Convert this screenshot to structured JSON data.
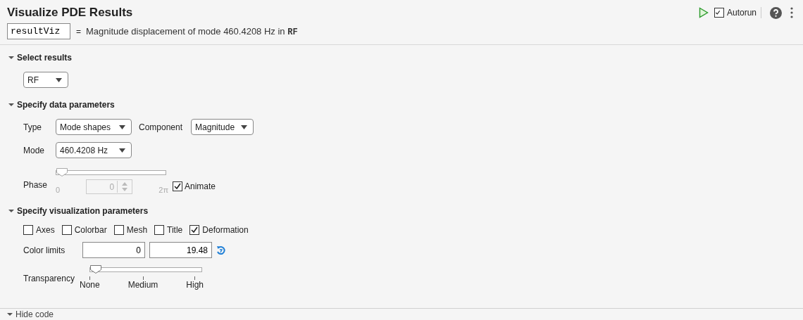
{
  "header": {
    "title": "Visualize PDE Results",
    "autorun": {
      "label": "Autorun",
      "checked": true
    },
    "variable": "resultViz",
    "equals": "=",
    "description": "Magnitude displacement of mode 460.4208 Hz in ",
    "source": "RF"
  },
  "sections": [
    {
      "kind": "select",
      "title": "Select results",
      "expanded": true,
      "dropdown": "RF"
    },
    {
      "kind": "data",
      "title": "Specify data parameters",
      "expanded": true,
      "type_label": "Type",
      "type_value": "Mode shapes",
      "component_label": "Component",
      "component_value": "Magnitude",
      "mode_label": "Mode",
      "mode_value": "460.4208 Hz",
      "phase": {
        "label": "Phase",
        "level": 0,
        "disabled": true,
        "min_label": "0",
        "max_label": "2π",
        "value": "0"
      },
      "animate": {
        "label": "Animate",
        "checked": true
      }
    },
    {
      "kind": "viz",
      "title": "Specify visualization parameters",
      "expanded": true,
      "options": [
        {
          "label": "Axes",
          "checked": false
        },
        {
          "label": "Colorbar",
          "checked": false
        },
        {
          "label": "Mesh",
          "checked": false
        },
        {
          "label": "Title",
          "checked": false
        },
        {
          "label": "Deformation",
          "checked": true
        }
      ],
      "color_limits_label": "Color limits",
      "color_min": "0",
      "color_max": "19.48",
      "transparency": {
        "label": "Transparency",
        "level": 0,
        "ticks": [
          "None",
          "Medium",
          "High"
        ]
      }
    }
  ],
  "footer": {
    "label": "Hide code",
    "expanded": true
  }
}
